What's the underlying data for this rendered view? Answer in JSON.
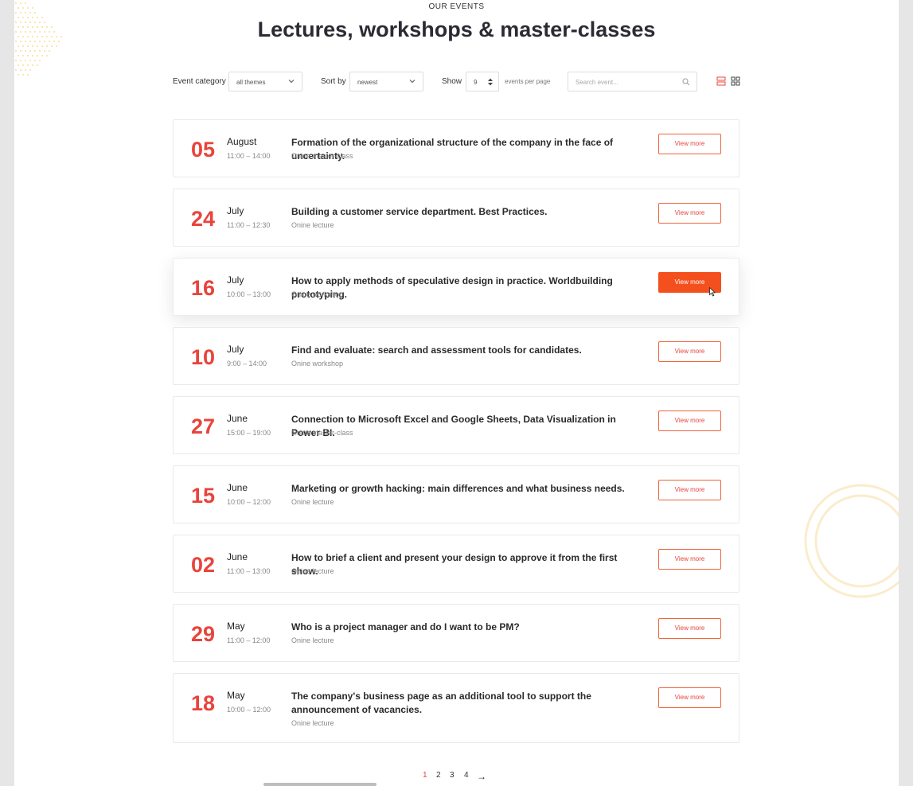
{
  "header": {
    "eyebrow": "OUR EVENTS",
    "title": "Lectures, workshops & master-classes"
  },
  "filters": {
    "category_label": "Event category",
    "category_value": "all themes",
    "sort_label": "Sort by",
    "sort_value": "newest",
    "show_label": "Show",
    "show_value": "9",
    "per_page_label": "events per page",
    "search_placeholder": "Search event..."
  },
  "events": [
    {
      "day": "05",
      "month": "August",
      "time": "11:00 – 14:00",
      "title": "Formation of the organizational structure of the company in the face of uncertainty.",
      "type": "Onine master-class",
      "button": "View more"
    },
    {
      "day": "24",
      "month": "July",
      "time": "11:00 – 12:30",
      "title": "Building a customer service department. Best Practices.",
      "type": "Onine lecture",
      "button": "View more"
    },
    {
      "day": "16",
      "month": "July",
      "time": "10:00 – 13:00",
      "title": "How to apply methods of speculative design in practice. Worldbuilding prototyping.",
      "type": "Onine workshop",
      "button": "View more"
    },
    {
      "day": "10",
      "month": "July",
      "time": "9:00 – 14:00",
      "title": "Find and evaluate: search and assessment tools for candidates.",
      "type": "Onine workshop",
      "button": "View more"
    },
    {
      "day": "27",
      "month": "June",
      "time": "15:00 – 19:00",
      "title": "Connection to Microsoft Excel and Google Sheets, Data Visualization in Power BI.",
      "type": "Onine master-class",
      "button": "View more"
    },
    {
      "day": "15",
      "month": "June",
      "time": "10:00 – 12:00",
      "title": "Marketing or growth hacking: main differences and what business needs.",
      "type": "Onine lecture",
      "button": "View more"
    },
    {
      "day": "02",
      "month": "June",
      "time": "11:00 – 13:00",
      "title": "How to brief a client and present your design to approve it from the first show.",
      "type": "Onine lecture",
      "button": "View more"
    },
    {
      "day": "29",
      "month": "May",
      "time": "11:00 – 12:00",
      "title": "Who is a project manager and do I want to be PM?",
      "type": "Onine lecture",
      "button": "View more"
    },
    {
      "day": "18",
      "month": "May",
      "time": "10:00 – 12:00",
      "title": "The company's business page as an additional tool to support the announcement of vacancies.",
      "type": "Onine lecture",
      "button": "View more"
    }
  ],
  "active_event_index": 2,
  "pagination": {
    "pages": [
      "1",
      "2",
      "3",
      "4"
    ],
    "current": "1",
    "next_arrow": "→"
  },
  "colors": {
    "accent": "#e8443c",
    "button_active": "#f4501e",
    "decor_dots": "#f3d77a",
    "decor_rings": "#fbeccb"
  },
  "icons": {
    "view_list": "list-view-icon",
    "view_grid": "grid-view-icon",
    "search": "search-icon",
    "select": "chevron-down-icon",
    "stepper": "stepper-icon"
  }
}
